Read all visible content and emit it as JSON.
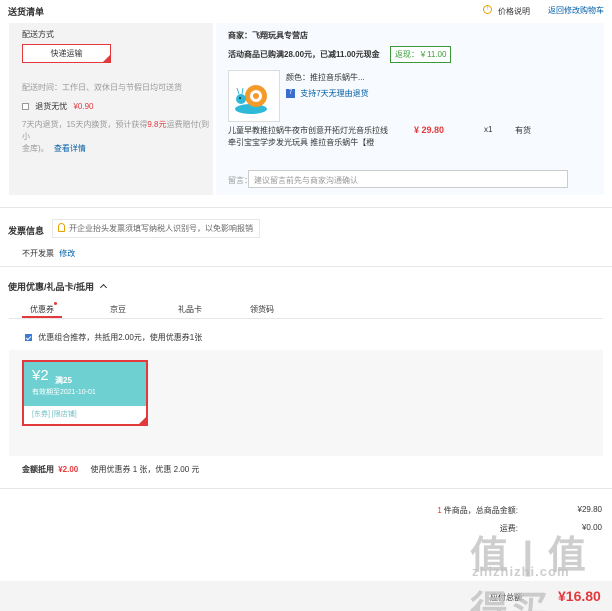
{
  "header": {
    "title": "送货清单",
    "price_note": "价格说明",
    "back_to_cart": "返回修改购物车"
  },
  "delivery": {
    "method_label": "配送方式",
    "method_value": "快递运输",
    "time_text": "配送时间：工作日、双休日与节假日均可送货",
    "return_worry_free": "退货无忧",
    "return_price": "¥0.90",
    "return_desc_1": "7天内退货，15天内换货，预计获得",
    "return_desc_highlight": "9.8元",
    "return_desc_2": "运费赔付(到小",
    "return_desc_3": "金库)。",
    "detail_link": "查看详情"
  },
  "shop": {
    "merchant": "商家：飞翔玩具专营店",
    "promo": "活动商品已购满28.00元，已减11.00元现金",
    "rebate": "返现：￥11.00",
    "color_label": "颜色：推拉音乐蜗牛...",
    "seven_day": "支持7天无理由退货",
    "product_name_1": "儿童早教推拉蜗牛夜市创意开拓灯光音乐拉线",
    "product_name_2": "牵引宝宝学步发光玩具 推拉音乐蜗牛【橙",
    "price": "¥ 29.80",
    "qty": "x1",
    "stock": "有货",
    "remark_label": "留言：",
    "remark_placeholder": "建议留言前先与商家沟通确认"
  },
  "invoice": {
    "title": "发票信息",
    "tip": "开企业抬头发票须填写纳税人识别号，以免影响报销",
    "status": "不开发票",
    "edit": "修改"
  },
  "coupons": {
    "title": "使用优惠/礼品卡/抵用",
    "tabs": [
      "优惠券",
      "京豆",
      "礼品卡",
      "领货码"
    ],
    "combo_text": "优惠组合推荐，共抵用2.00元，使用优惠券1张",
    "card_amount": "¥2",
    "card_condition": "满25",
    "card_valid": "有效期至2021-10-01",
    "card_tag_1": "[东券]",
    "card_tag_2": "[限店铺]",
    "summary_label": "金额抵用",
    "summary_amount": "¥2.00",
    "summary_desc": "使用优惠券 1 张，优惠 2.00 元"
  },
  "totals": {
    "count_num": "1",
    "count_text": "件商品，总商品金额:",
    "goods_amount": "¥29.80",
    "freight_label": "运费:",
    "freight_amount": "¥0.00",
    "payable_label": "应付总额:",
    "payable_amount": "¥16.80"
  },
  "watermark": {
    "text": "值 | 值得买",
    "domain": "zhizhizhi.com"
  },
  "colors": {
    "accent_red": "#e4393c",
    "panel_bg": "#f3f3f3",
    "coupon_teal": "#6fd0d2",
    "rebate_green": "#3a9a3a",
    "link_blue": "#005ea7"
  }
}
